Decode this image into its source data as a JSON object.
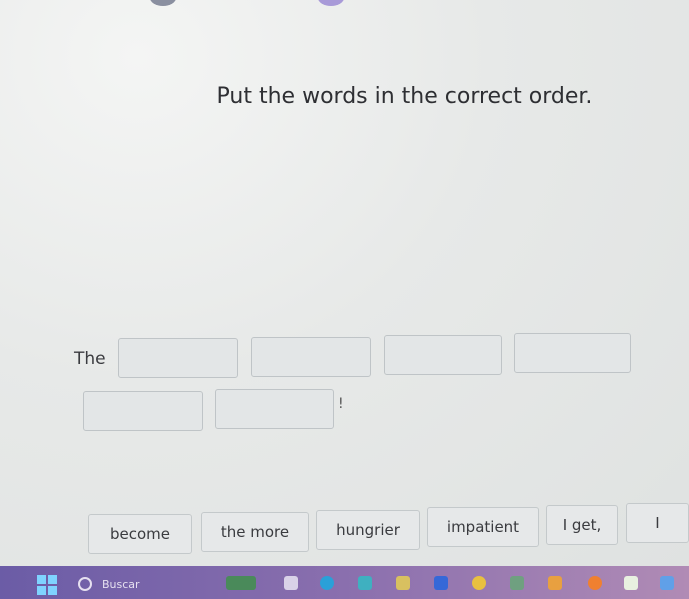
{
  "exercise": {
    "instruction": "Put the words in the correct order.",
    "sentence_start": "The",
    "sentence_end": "!",
    "answer_slots": 6,
    "word_bank": [
      "become",
      "the more",
      "hungrier",
      "impatient",
      "I get,",
      "I"
    ]
  },
  "taskbar": {
    "search_placeholder": "Buscar",
    "icons": [
      "windows-start-icon",
      "search-icon",
      "weather-icon",
      "file-icon",
      "edge-browser-icon",
      "copilot-icon",
      "store-icon",
      "dropbox-icon",
      "chrome-icon",
      "app-icon",
      "folder-icon",
      "firefox-icon",
      "check-icon",
      "vpn-icon"
    ]
  }
}
